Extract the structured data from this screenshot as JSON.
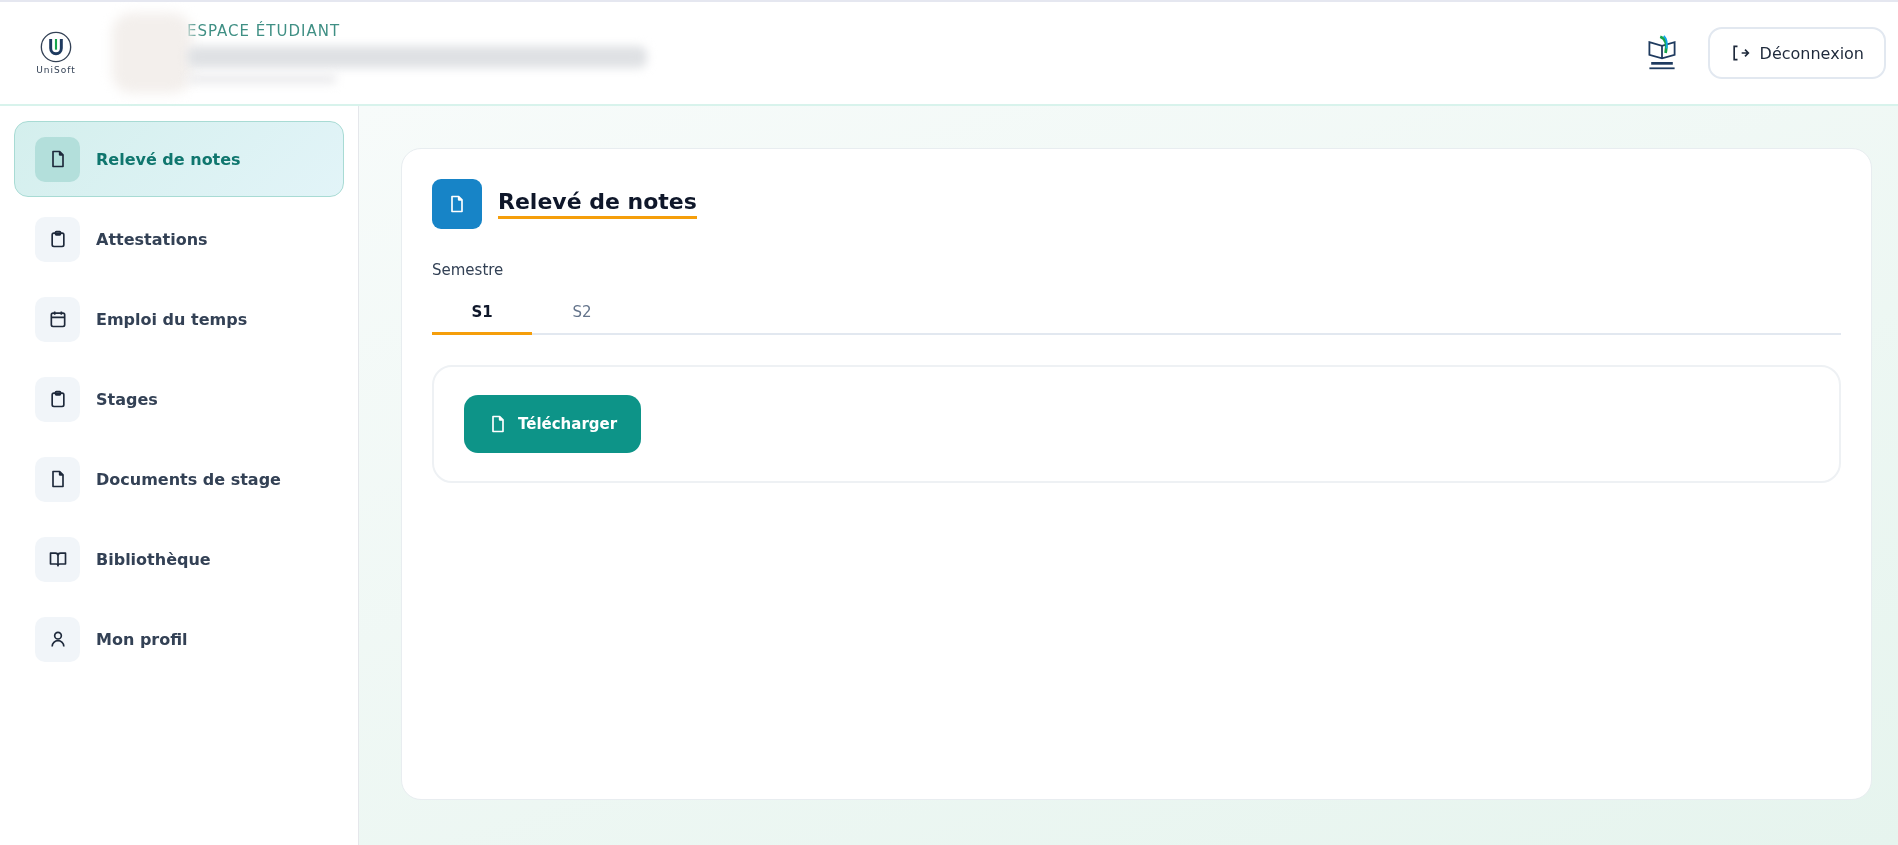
{
  "header": {
    "logo_text": "UniSoft",
    "eyebrow": "ESPACE ÉTUDIANT",
    "logout_button": "Déconnexion"
  },
  "sidebar": {
    "items": [
      {
        "label": "Relevé de notes",
        "kind": "file",
        "selected": true
      },
      {
        "label": "Attestations",
        "kind": "clipboard",
        "selected": false
      },
      {
        "label": "Emploi du temps",
        "kind": "calendar",
        "selected": false
      },
      {
        "label": "Stages",
        "kind": "clipboard",
        "selected": false
      },
      {
        "label": "Documents de stage",
        "kind": "file",
        "selected": false
      },
      {
        "label": "Bibliothèque",
        "kind": "book",
        "selected": false
      },
      {
        "label": "Mon profil",
        "kind": "user",
        "selected": false
      }
    ]
  },
  "main": {
    "title": "Relevé de notes",
    "semester_label": "Semestre",
    "tabs": [
      {
        "label": "S1",
        "selected": true
      },
      {
        "label": "S2",
        "selected": false
      }
    ],
    "download_button": "Télécharger"
  }
}
